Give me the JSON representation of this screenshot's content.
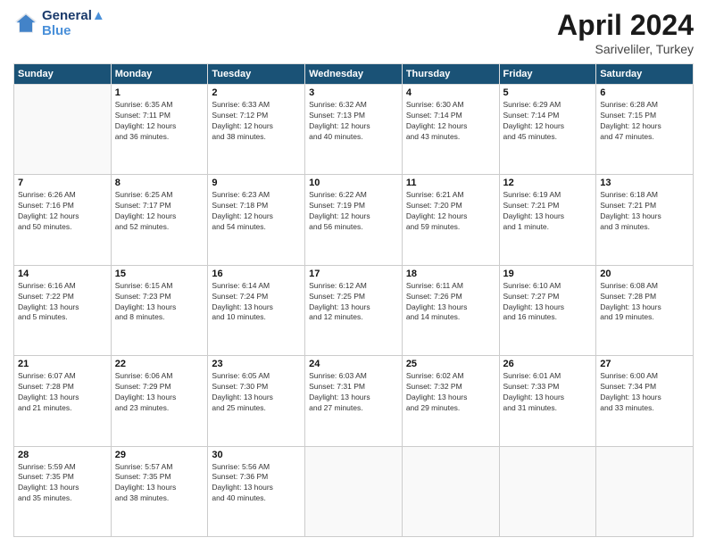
{
  "header": {
    "logo_line1": "General",
    "logo_line2": "Blue",
    "month": "April 2024",
    "location": "Sariveliler, Turkey"
  },
  "weekdays": [
    "Sunday",
    "Monday",
    "Tuesday",
    "Wednesday",
    "Thursday",
    "Friday",
    "Saturday"
  ],
  "weeks": [
    [
      {
        "day": "",
        "info": ""
      },
      {
        "day": "1",
        "info": "Sunrise: 6:35 AM\nSunset: 7:11 PM\nDaylight: 12 hours\nand 36 minutes."
      },
      {
        "day": "2",
        "info": "Sunrise: 6:33 AM\nSunset: 7:12 PM\nDaylight: 12 hours\nand 38 minutes."
      },
      {
        "day": "3",
        "info": "Sunrise: 6:32 AM\nSunset: 7:13 PM\nDaylight: 12 hours\nand 40 minutes."
      },
      {
        "day": "4",
        "info": "Sunrise: 6:30 AM\nSunset: 7:14 PM\nDaylight: 12 hours\nand 43 minutes."
      },
      {
        "day": "5",
        "info": "Sunrise: 6:29 AM\nSunset: 7:14 PM\nDaylight: 12 hours\nand 45 minutes."
      },
      {
        "day": "6",
        "info": "Sunrise: 6:28 AM\nSunset: 7:15 PM\nDaylight: 12 hours\nand 47 minutes."
      }
    ],
    [
      {
        "day": "7",
        "info": "Sunrise: 6:26 AM\nSunset: 7:16 PM\nDaylight: 12 hours\nand 50 minutes."
      },
      {
        "day": "8",
        "info": "Sunrise: 6:25 AM\nSunset: 7:17 PM\nDaylight: 12 hours\nand 52 minutes."
      },
      {
        "day": "9",
        "info": "Sunrise: 6:23 AM\nSunset: 7:18 PM\nDaylight: 12 hours\nand 54 minutes."
      },
      {
        "day": "10",
        "info": "Sunrise: 6:22 AM\nSunset: 7:19 PM\nDaylight: 12 hours\nand 56 minutes."
      },
      {
        "day": "11",
        "info": "Sunrise: 6:21 AM\nSunset: 7:20 PM\nDaylight: 12 hours\nand 59 minutes."
      },
      {
        "day": "12",
        "info": "Sunrise: 6:19 AM\nSunset: 7:21 PM\nDaylight: 13 hours\nand 1 minute."
      },
      {
        "day": "13",
        "info": "Sunrise: 6:18 AM\nSunset: 7:21 PM\nDaylight: 13 hours\nand 3 minutes."
      }
    ],
    [
      {
        "day": "14",
        "info": "Sunrise: 6:16 AM\nSunset: 7:22 PM\nDaylight: 13 hours\nand 5 minutes."
      },
      {
        "day": "15",
        "info": "Sunrise: 6:15 AM\nSunset: 7:23 PM\nDaylight: 13 hours\nand 8 minutes."
      },
      {
        "day": "16",
        "info": "Sunrise: 6:14 AM\nSunset: 7:24 PM\nDaylight: 13 hours\nand 10 minutes."
      },
      {
        "day": "17",
        "info": "Sunrise: 6:12 AM\nSunset: 7:25 PM\nDaylight: 13 hours\nand 12 minutes."
      },
      {
        "day": "18",
        "info": "Sunrise: 6:11 AM\nSunset: 7:26 PM\nDaylight: 13 hours\nand 14 minutes."
      },
      {
        "day": "19",
        "info": "Sunrise: 6:10 AM\nSunset: 7:27 PM\nDaylight: 13 hours\nand 16 minutes."
      },
      {
        "day": "20",
        "info": "Sunrise: 6:08 AM\nSunset: 7:28 PM\nDaylight: 13 hours\nand 19 minutes."
      }
    ],
    [
      {
        "day": "21",
        "info": "Sunrise: 6:07 AM\nSunset: 7:28 PM\nDaylight: 13 hours\nand 21 minutes."
      },
      {
        "day": "22",
        "info": "Sunrise: 6:06 AM\nSunset: 7:29 PM\nDaylight: 13 hours\nand 23 minutes."
      },
      {
        "day": "23",
        "info": "Sunrise: 6:05 AM\nSunset: 7:30 PM\nDaylight: 13 hours\nand 25 minutes."
      },
      {
        "day": "24",
        "info": "Sunrise: 6:03 AM\nSunset: 7:31 PM\nDaylight: 13 hours\nand 27 minutes."
      },
      {
        "day": "25",
        "info": "Sunrise: 6:02 AM\nSunset: 7:32 PM\nDaylight: 13 hours\nand 29 minutes."
      },
      {
        "day": "26",
        "info": "Sunrise: 6:01 AM\nSunset: 7:33 PM\nDaylight: 13 hours\nand 31 minutes."
      },
      {
        "day": "27",
        "info": "Sunrise: 6:00 AM\nSunset: 7:34 PM\nDaylight: 13 hours\nand 33 minutes."
      }
    ],
    [
      {
        "day": "28",
        "info": "Sunrise: 5:59 AM\nSunset: 7:35 PM\nDaylight: 13 hours\nand 35 minutes."
      },
      {
        "day": "29",
        "info": "Sunrise: 5:57 AM\nSunset: 7:35 PM\nDaylight: 13 hours\nand 38 minutes."
      },
      {
        "day": "30",
        "info": "Sunrise: 5:56 AM\nSunset: 7:36 PM\nDaylight: 13 hours\nand 40 minutes."
      },
      {
        "day": "",
        "info": ""
      },
      {
        "day": "",
        "info": ""
      },
      {
        "day": "",
        "info": ""
      },
      {
        "day": "",
        "info": ""
      }
    ]
  ]
}
